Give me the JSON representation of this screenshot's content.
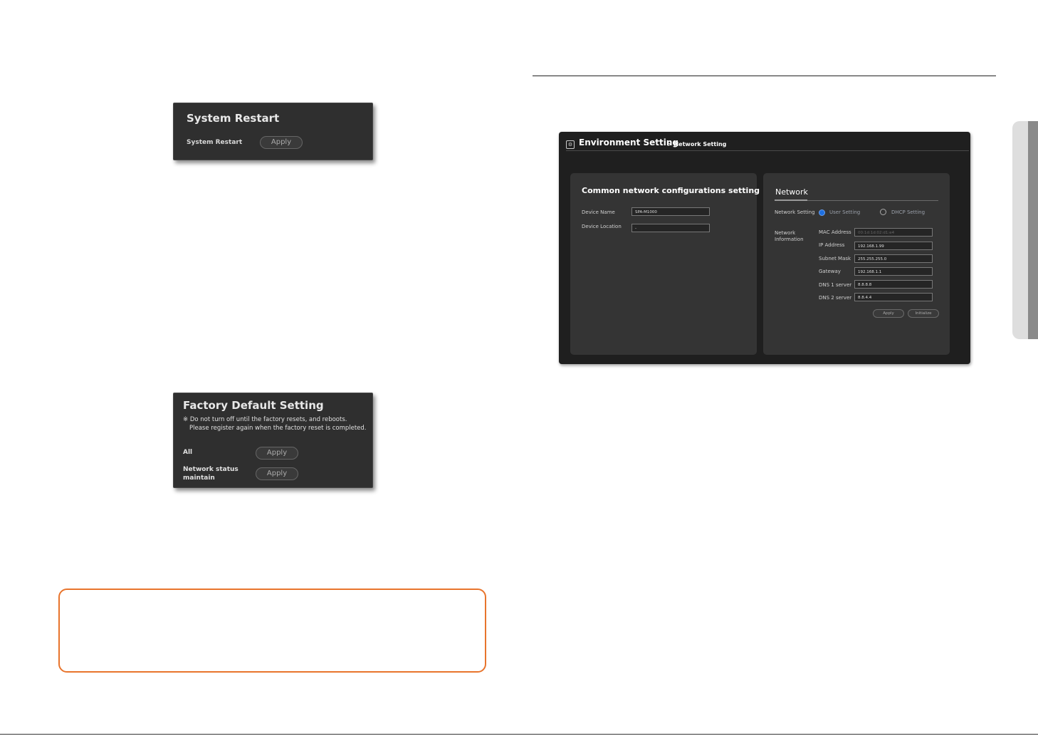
{
  "system_restart": {
    "title": "System Restart",
    "label": "System Restart",
    "apply": "Apply"
  },
  "factory_default": {
    "title": "Factory Default Setting",
    "note_line1": "※ Do not turn off until the factory resets, and reboots.",
    "note_line2": "Please register again when the factory reset is completed.",
    "all_label": "All",
    "all_apply": "Apply",
    "network_label": "Network status maintain",
    "network_apply": "Apply"
  },
  "environment": {
    "title": "Environment Setting",
    "breadcrumb": "> Network Setting",
    "common": {
      "title": "Common network configurations setting",
      "device_name_label": "Device Name",
      "device_name_value": "SPA-M1000",
      "device_location_label": "Device Location",
      "device_location_value": "-"
    },
    "network": {
      "title": "Network",
      "setting_label": "Network Setting",
      "user_setting": "User Setting",
      "dhcp_setting": "DHCP Setting",
      "info_label_1": "Network",
      "info_label_2": "Information",
      "fields": [
        {
          "label": "MAC Address",
          "value": "00:1d:1d:02:d1:e4"
        },
        {
          "label": "IP Address",
          "value": "192.168.1.99"
        },
        {
          "label": "Subnet Mask",
          "value": "255.255.255.0"
        },
        {
          "label": "Gateway",
          "value": "192.168.1.1"
        },
        {
          "label": "DNS 1 server",
          "value": "8.8.8.8"
        },
        {
          "label": "DNS 2 server",
          "value": "8.8.4.4"
        }
      ],
      "apply": "Apply",
      "initialize": "Initialize"
    }
  }
}
